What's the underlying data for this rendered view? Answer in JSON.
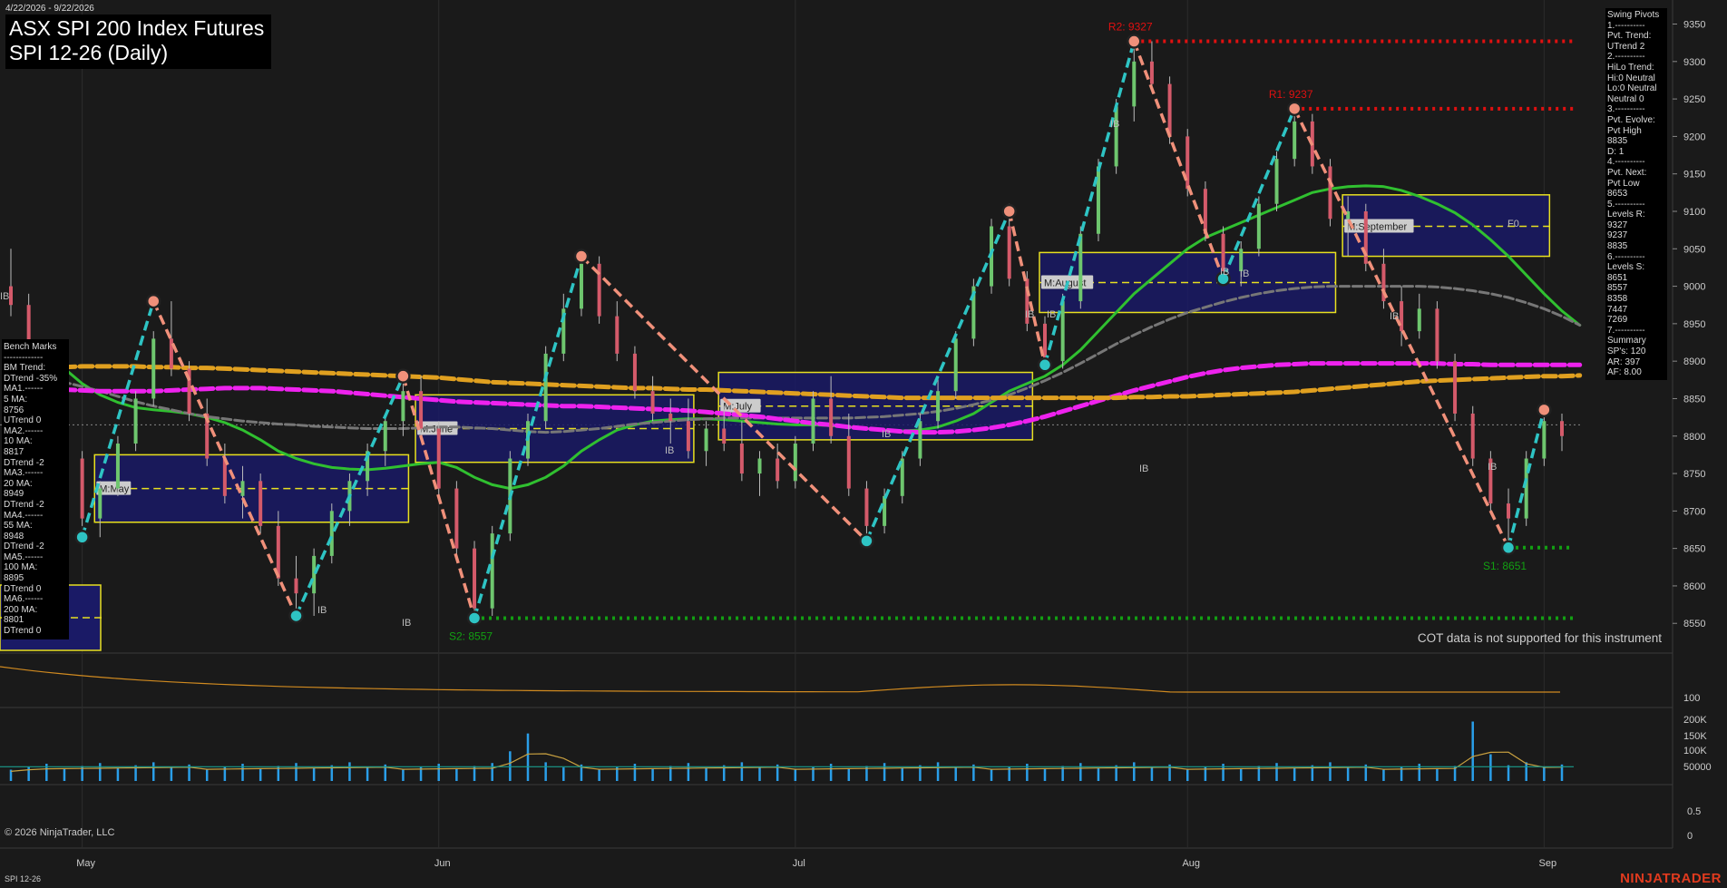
{
  "header": {
    "date_range": "4/22/2026 - 9/22/2026",
    "title_line1": "ASX SPI 200 Index Futures",
    "title_line2": "SPI 12-26 (Daily)"
  },
  "bench_marks": [
    "Bench Marks",
    "-------------",
    "BM Trend:",
    "DTrend -35%",
    "MA1.------",
    "5 MA:",
    "8756",
    "UTrend 0",
    "MA2.------",
    "10 MA:",
    "8817",
    "DTrend -2",
    "MA3.------",
    "20 MA:",
    "8949",
    "DTrend -2",
    "MA4.------",
    "55 MA:",
    "8948",
    "DTrend -2",
    "MA5.------",
    "100 MA:",
    "8895",
    "DTrend 0",
    "MA6.------",
    "200 MA:",
    "8801",
    "DTrend 0"
  ],
  "swing_pivots": [
    "Swing Pivots",
    "1.----------",
    "Pvt. Trend:",
    "UTrend 2",
    "2.----------",
    "HiLo Trend:",
    "Hi:0 Neutral",
    "Lo:0 Neutral",
    "Neutral 0",
    "3.----------",
    "Pvt. Evolve:",
    "Pvt High",
    "8835",
    "D: 1",
    "4.----------",
    "Pvt. Next:",
    "Pvt Low",
    "8653",
    "5.----------",
    "Levels R:",
    "9327",
    "9237",
    "8835",
    "6.----------",
    "Levels S:",
    "8651",
    "8557",
    "8358",
    "7447",
    "7269",
    "7.----------",
    "Summary",
    "SP's: 120",
    "AR: 397",
    "AF: 8.00"
  ],
  "footer": {
    "cot_note": "COT data is not supported for this instrument",
    "copyright": "© 2026 NinjaTrader, LLC",
    "instrument": "SPI 12-26",
    "brand": "NINJATRADER"
  },
  "colors": {
    "background": "#1a1a1a",
    "bull_candle": "#6ec66e",
    "bear_candle": "#d45a6a",
    "pivot_up_line": "#2ec4c4",
    "pivot_down_line": "#f0907a",
    "resistance": "#e01010",
    "support": "#12a012",
    "ma_green": "#30c030",
    "ma_teal": "#1a9c8c",
    "ma_gray": "#777777",
    "ma_magenta": "#ee22ee",
    "ma_orange": "#e0a020",
    "range_box": "#1a1a66",
    "range_border": "#e8e020"
  },
  "chart_data": {
    "type": "candlestick",
    "price_axis": {
      "ticks": [
        8550,
        8600,
        8650,
        8700,
        8750,
        8800,
        8850,
        8900,
        8950,
        9000,
        9050,
        9100,
        9150,
        9200,
        9250,
        9300,
        9350
      ],
      "ylim": [
        8520,
        9370
      ]
    },
    "time_axis": {
      "labels": [
        "May",
        "Jun",
        "Jul",
        "Aug",
        "Sep"
      ],
      "label_day_index": [
        4,
        24,
        44,
        66,
        86
      ]
    },
    "candles": [
      {
        "o": 9000,
        "h": 9050,
        "l": 8960,
        "c": 8975
      },
      {
        "o": 8975,
        "h": 8990,
        "l": 8880,
        "c": 8895
      },
      {
        "o": 8895,
        "h": 8900,
        "l": 8830,
        "c": 8850
      },
      {
        "o": 8850,
        "h": 8860,
        "l": 8760,
        "c": 8770
      },
      {
        "o": 8770,
        "h": 8780,
        "l": 8680,
        "c": 8690
      },
      {
        "o": 8690,
        "h": 8740,
        "l": 8665,
        "c": 8730
      },
      {
        "o": 8730,
        "h": 8800,
        "l": 8720,
        "c": 8790
      },
      {
        "o": 8790,
        "h": 8860,
        "l": 8780,
        "c": 8850
      },
      {
        "o": 8850,
        "h": 8940,
        "l": 8840,
        "c": 8930
      },
      {
        "o": 8930,
        "h": 8980,
        "l": 8880,
        "c": 8890
      },
      {
        "o": 8890,
        "h": 8900,
        "l": 8820,
        "c": 8830
      },
      {
        "o": 8830,
        "h": 8850,
        "l": 8760,
        "c": 8770
      },
      {
        "o": 8770,
        "h": 8790,
        "l": 8710,
        "c": 8720
      },
      {
        "o": 8720,
        "h": 8760,
        "l": 8690,
        "c": 8740
      },
      {
        "o": 8740,
        "h": 8750,
        "l": 8670,
        "c": 8680
      },
      {
        "o": 8680,
        "h": 8700,
        "l": 8600,
        "c": 8610
      },
      {
        "o": 8610,
        "h": 8640,
        "l": 8560,
        "c": 8590
      },
      {
        "o": 8590,
        "h": 8650,
        "l": 8560,
        "c": 8640
      },
      {
        "o": 8640,
        "h": 8710,
        "l": 8630,
        "c": 8700
      },
      {
        "o": 8700,
        "h": 8750,
        "l": 8680,
        "c": 8740
      },
      {
        "o": 8740,
        "h": 8790,
        "l": 8720,
        "c": 8780
      },
      {
        "o": 8780,
        "h": 8830,
        "l": 8760,
        "c": 8820
      },
      {
        "o": 8820,
        "h": 8870,
        "l": 8800,
        "c": 8860
      },
      {
        "o": 8860,
        "h": 8880,
        "l": 8800,
        "c": 8810
      },
      {
        "o": 8810,
        "h": 8820,
        "l": 8720,
        "c": 8730
      },
      {
        "o": 8730,
        "h": 8740,
        "l": 8640,
        "c": 8650
      },
      {
        "o": 8650,
        "h": 8660,
        "l": 8560,
        "c": 8570
      },
      {
        "o": 8570,
        "h": 8680,
        "l": 8560,
        "c": 8670
      },
      {
        "o": 8670,
        "h": 8780,
        "l": 8660,
        "c": 8770
      },
      {
        "o": 8770,
        "h": 8830,
        "l": 8760,
        "c": 8820
      },
      {
        "o": 8820,
        "h": 8920,
        "l": 8810,
        "c": 8910
      },
      {
        "o": 8910,
        "h": 8990,
        "l": 8900,
        "c": 8970
      },
      {
        "o": 8970,
        "h": 9040,
        "l": 8960,
        "c": 9030
      },
      {
        "o": 9030,
        "h": 9040,
        "l": 8950,
        "c": 8960
      },
      {
        "o": 8960,
        "h": 8980,
        "l": 8900,
        "c": 8910
      },
      {
        "o": 8910,
        "h": 8920,
        "l": 8850,
        "c": 8860
      },
      {
        "o": 8860,
        "h": 8880,
        "l": 8820,
        "c": 8830
      },
      {
        "o": 8830,
        "h": 8850,
        "l": 8790,
        "c": 8820
      },
      {
        "o": 8820,
        "h": 8850,
        "l": 8770,
        "c": 8780
      },
      {
        "o": 8780,
        "h": 8820,
        "l": 8760,
        "c": 8810
      },
      {
        "o": 8810,
        "h": 8840,
        "l": 8780,
        "c": 8790
      },
      {
        "o": 8790,
        "h": 8820,
        "l": 8740,
        "c": 8750
      },
      {
        "o": 8750,
        "h": 8780,
        "l": 8720,
        "c": 8770
      },
      {
        "o": 8770,
        "h": 8790,
        "l": 8730,
        "c": 8740
      },
      {
        "o": 8740,
        "h": 8800,
        "l": 8730,
        "c": 8790
      },
      {
        "o": 8790,
        "h": 8860,
        "l": 8780,
        "c": 8850
      },
      {
        "o": 8850,
        "h": 8880,
        "l": 8790,
        "c": 8800
      },
      {
        "o": 8800,
        "h": 8830,
        "l": 8720,
        "c": 8730
      },
      {
        "o": 8730,
        "h": 8740,
        "l": 8660,
        "c": 8680
      },
      {
        "o": 8680,
        "h": 8730,
        "l": 8670,
        "c": 8720
      },
      {
        "o": 8720,
        "h": 8780,
        "l": 8710,
        "c": 8770
      },
      {
        "o": 8770,
        "h": 8830,
        "l": 8760,
        "c": 8820
      },
      {
        "o": 8820,
        "h": 8880,
        "l": 8810,
        "c": 8860
      },
      {
        "o": 8860,
        "h": 8940,
        "l": 8850,
        "c": 8930
      },
      {
        "o": 8930,
        "h": 9010,
        "l": 8920,
        "c": 9000
      },
      {
        "o": 9000,
        "h": 9090,
        "l": 8990,
        "c": 9080
      },
      {
        "o": 9080,
        "h": 9110,
        "l": 9000,
        "c": 9010
      },
      {
        "o": 9010,
        "h": 9020,
        "l": 8940,
        "c": 8950
      },
      {
        "o": 8950,
        "h": 8960,
        "l": 8890,
        "c": 8900
      },
      {
        "o": 8900,
        "h": 8990,
        "l": 8890,
        "c": 8980
      },
      {
        "o": 8980,
        "h": 9080,
        "l": 8970,
        "c": 9070
      },
      {
        "o": 9070,
        "h": 9170,
        "l": 9060,
        "c": 9160
      },
      {
        "o": 9160,
        "h": 9250,
        "l": 9150,
        "c": 9240
      },
      {
        "o": 9240,
        "h": 9320,
        "l": 9220,
        "c": 9300
      },
      {
        "o": 9300,
        "h": 9327,
        "l": 9260,
        "c": 9270
      },
      {
        "o": 9270,
        "h": 9280,
        "l": 9190,
        "c": 9200
      },
      {
        "o": 9200,
        "h": 9210,
        "l": 9120,
        "c": 9130
      },
      {
        "o": 9130,
        "h": 9140,
        "l": 9060,
        "c": 9070
      },
      {
        "o": 9070,
        "h": 9080,
        "l": 9010,
        "c": 9020
      },
      {
        "o": 9020,
        "h": 9060,
        "l": 9000,
        "c": 9050
      },
      {
        "o": 9050,
        "h": 9120,
        "l": 9040,
        "c": 9110
      },
      {
        "o": 9110,
        "h": 9180,
        "l": 9100,
        "c": 9170
      },
      {
        "o": 9170,
        "h": 9237,
        "l": 9160,
        "c": 9220
      },
      {
        "o": 9220,
        "h": 9230,
        "l": 9150,
        "c": 9160
      },
      {
        "o": 9160,
        "h": 9170,
        "l": 9080,
        "c": 9090
      },
      {
        "o": 9090,
        "h": 9120,
        "l": 9040,
        "c": 9100
      },
      {
        "o": 9100,
        "h": 9110,
        "l": 9020,
        "c": 9030
      },
      {
        "o": 9030,
        "h": 9050,
        "l": 8970,
        "c": 8980
      },
      {
        "o": 8980,
        "h": 9000,
        "l": 8920,
        "c": 8940
      },
      {
        "o": 8940,
        "h": 8990,
        "l": 8930,
        "c": 8970
      },
      {
        "o": 8970,
        "h": 8980,
        "l": 8890,
        "c": 8900
      },
      {
        "o": 8900,
        "h": 8910,
        "l": 8820,
        "c": 8830
      },
      {
        "o": 8830,
        "h": 8840,
        "l": 8760,
        "c": 8770
      },
      {
        "o": 8770,
        "h": 8780,
        "l": 8700,
        "c": 8710
      },
      {
        "o": 8710,
        "h": 8730,
        "l": 8651,
        "c": 8690
      },
      {
        "o": 8690,
        "h": 8780,
        "l": 8680,
        "c": 8770
      },
      {
        "o": 8770,
        "h": 8835,
        "l": 8760,
        "c": 8820
      },
      {
        "o": 8820,
        "h": 8830,
        "l": 8780,
        "c": 8800
      }
    ],
    "moving_averages": [
      {
        "period": 20,
        "color": "#30c030",
        "values": [
          8920,
          8915,
          8905,
          8890,
          8870,
          8855,
          8845,
          8838,
          8835,
          8833,
          8830,
          8825,
          8818,
          8808,
          8795,
          8780,
          8770,
          8763,
          8758,
          8756,
          8755,
          8757,
          8760,
          8763,
          8765,
          8758,
          8745,
          8735,
          8730,
          8735,
          8745,
          8760,
          8780,
          8795,
          8808,
          8815,
          8820,
          8822,
          8823,
          8823,
          8822,
          8820,
          8818,
          8816,
          8815,
          8815,
          8814,
          8812,
          8810,
          8808,
          8807,
          8808,
          8812,
          8820,
          8830,
          8845,
          8860,
          8870,
          8880,
          8895,
          8915,
          8940,
          8965,
          8990,
          9010,
          9030,
          9050,
          9065,
          9075,
          9085,
          9095,
          9105,
          9115,
          9125,
          9130,
          9133,
          9134,
          9133,
          9128,
          9120,
          9110,
          9098,
          9082,
          9062,
          9040,
          9015,
          8990,
          8967,
          8948
        ]
      },
      {
        "period": 55,
        "color": "#777777",
        "values": [
          8880,
          8878,
          8876,
          8872,
          8866,
          8860,
          8853,
          8846,
          8840,
          8835,
          8830,
          8826,
          8823,
          8820,
          8818,
          8816,
          8815,
          8813,
          8812,
          8811,
          8810,
          8810,
          8810,
          8811,
          8812,
          8812,
          8811,
          8810,
          8808,
          8806,
          8805,
          8806,
          8808,
          8810,
          8813,
          8816,
          8818,
          8820,
          8822,
          8823,
          8824,
          8824,
          8824,
          8824,
          8824,
          8824,
          8824,
          8824,
          8825,
          8826,
          8828,
          8830,
          8833,
          8837,
          8842,
          8848,
          8855,
          8864,
          8874,
          8885,
          8897,
          8910,
          8923,
          8935,
          8946,
          8956,
          8965,
          8972,
          8979,
          8985,
          8990,
          8994,
          8997,
          8999,
          9000,
          9000,
          9000,
          9000,
          9000,
          9000,
          8999,
          8997,
          8994,
          8990,
          8985,
          8978,
          8970,
          8960,
          8948
        ]
      },
      {
        "period": 100,
        "color": "#ee22ee",
        "values": [
          8865,
          8864,
          8863,
          8862,
          8861,
          8860,
          8860,
          8860,
          8860,
          8861,
          8862,
          8863,
          8864,
          8864,
          8864,
          8863,
          8862,
          8861,
          8860,
          8858,
          8856,
          8854,
          8852,
          8850,
          8848,
          8846,
          8845,
          8844,
          8843,
          8842,
          8841,
          8840,
          8840,
          8839,
          8838,
          8837,
          8836,
          8835,
          8834,
          8832,
          8830,
          8828,
          8826,
          8823,
          8820,
          8817,
          8815,
          8812,
          8810,
          8808,
          8806,
          8805,
          8805,
          8806,
          8808,
          8811,
          8815,
          8820,
          8826,
          8833,
          8840,
          8847,
          8854,
          8861,
          8867,
          8873,
          8879,
          8884,
          8888,
          8891,
          8893,
          8895,
          8896,
          8897,
          8897,
          8897,
          8897,
          8897,
          8897,
          8897,
          8897,
          8896,
          8896,
          8895,
          8895,
          8895,
          8895,
          8895,
          8895
        ]
      },
      {
        "period": 200,
        "color": "#e0a020",
        "values": [
          8890,
          8890,
          8891,
          8892,
          8893,
          8893,
          8893,
          8893,
          8892,
          8892,
          8891,
          8891,
          8890,
          8889,
          8888,
          8887,
          8886,
          8885,
          8884,
          8883,
          8882,
          8881,
          8880,
          8879,
          8878,
          8876,
          8874,
          8872,
          8871,
          8870,
          8869,
          8868,
          8867,
          8866,
          8865,
          8864,
          8864,
          8863,
          8862,
          8862,
          8861,
          8860,
          8859,
          8858,
          8857,
          8856,
          8855,
          8854,
          8853,
          8852,
          8851,
          8851,
          8851,
          8851,
          8851,
          8851,
          8851,
          8851,
          8851,
          8851,
          8851,
          8851,
          8851,
          8852,
          8852,
          8853,
          8853,
          8854,
          8855,
          8856,
          8857,
          8858,
          8859,
          8861,
          8863,
          8865,
          8867,
          8869,
          8871,
          8873,
          8874,
          8875,
          8876,
          8877,
          8878,
          8879,
          8880,
          8880,
          8881
        ]
      }
    ],
    "swing_pivots": [
      {
        "i": 4,
        "price": 8665
      },
      {
        "i": 8,
        "price": 8980
      },
      {
        "i": 16,
        "price": 8560
      },
      {
        "i": 22,
        "price": 8880
      },
      {
        "i": 26,
        "price": 8557
      },
      {
        "i": 32,
        "price": 9040
      },
      {
        "i": 48,
        "price": 8660
      },
      {
        "i": 56,
        "price": 9100
      },
      {
        "i": 58,
        "price": 8895
      },
      {
        "i": 63,
        "price": 9327
      },
      {
        "i": 68,
        "price": 9010
      },
      {
        "i": 72,
        "price": 9237
      },
      {
        "i": 84,
        "price": 8651
      },
      {
        "i": 86,
        "price": 8835
      }
    ],
    "levels": [
      {
        "label": "R2: 9327",
        "price": 9327,
        "from": 63,
        "color": "#e01010"
      },
      {
        "label": "R1: 9237",
        "price": 9237,
        "from": 72,
        "color": "#e01010"
      },
      {
        "label": "S2: 8557",
        "price": 8557,
        "from": 26,
        "color": "#12a012"
      },
      {
        "label": "S1: 8651",
        "price": 8651,
        "from": 84,
        "color": "#12a012"
      }
    ],
    "range_boxes": [
      {
        "label": "M:May",
        "i0": 5,
        "i1": 22,
        "hi": 8775,
        "lo": 8685,
        "mid": 8730
      },
      {
        "label": "M:June",
        "i0": 23,
        "i1": 38,
        "hi": 8855,
        "lo": 8765,
        "mid": 8810
      },
      {
        "label": "M:July",
        "i0": 40,
        "i1": 57,
        "hi": 8885,
        "lo": 8795,
        "mid": 8840
      },
      {
        "label": "M:August",
        "i0": 58,
        "i1": 74,
        "hi": 9045,
        "lo": 8965,
        "mid": 9005
      },
      {
        "label": "M:September",
        "i0": 75,
        "i1": 86,
        "hi": 9122,
        "lo": 9040,
        "mid": 9080
      }
    ],
    "box_annotations": [
      "IB",
      "IB",
      "IB",
      "IB",
      "IB",
      "IB",
      "IB",
      "IB",
      "IB",
      "IB",
      "IB",
      "IB",
      "IB",
      "F0"
    ],
    "lower_panel_1": {
      "tick": "100"
    },
    "volume_panel": {
      "ticks": [
        "200K",
        "150K",
        "100K",
        "50000"
      ]
    },
    "lower_panel_3": {
      "ticks": [
        "0.5",
        "0"
      ]
    }
  }
}
